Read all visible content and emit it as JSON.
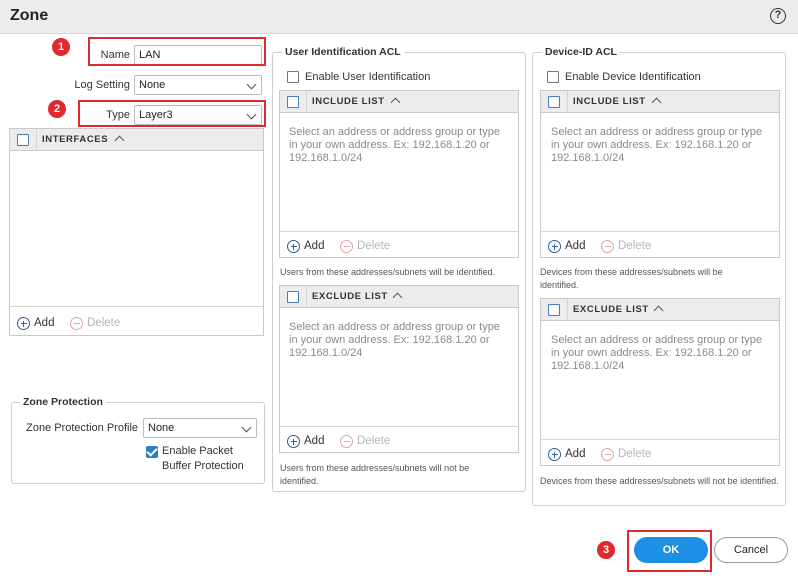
{
  "dialog": {
    "title": "Zone",
    "help": "?"
  },
  "form": {
    "name_label": "Name",
    "name_value": "LAN",
    "log_label": "Log Setting",
    "log_value": "None",
    "type_label": "Type",
    "type_value": "Layer3"
  },
  "interfaces": {
    "header": "INTERFACES",
    "add": "Add",
    "delete": "Delete"
  },
  "zone_protection": {
    "title": "Zone Protection",
    "profile_label": "Zone Protection Profile",
    "profile_value": "None",
    "packet_buffer_line1": "Enable Packet",
    "packet_buffer_line2": "Buffer Protection",
    "packet_buffer_checked": true
  },
  "user_acl": {
    "title": "User Identification ACL",
    "enable_label": "Enable User Identification",
    "include": {
      "header": "INCLUDE LIST",
      "placeholder_l1": "Select an address or address group or type",
      "placeholder_l2": "in your own address. Ex: 192.168.1.20 or",
      "placeholder_l3": "192.168.1.0/24",
      "add": "Add",
      "delete": "Delete"
    },
    "include_note": "Users from these addresses/subnets will be identified.",
    "exclude": {
      "header": "EXCLUDE LIST",
      "placeholder_l1": "Select an address or address group or type",
      "placeholder_l2": "in your own address. Ex: 192.168.1.20 or",
      "placeholder_l3": "192.168.1.0/24",
      "add": "Add",
      "delete": "Delete"
    },
    "exclude_note_l1": "Users from these addresses/subnets will not be",
    "exclude_note_l2": "identified."
  },
  "device_acl": {
    "title": "Device-ID ACL",
    "enable_label": "Enable Device Identification",
    "include": {
      "header": "INCLUDE LIST",
      "placeholder_l1": "Select an address or address group or type",
      "placeholder_l2": "in your own address. Ex: 192.168.1.20 or",
      "placeholder_l3": "192.168.1.0/24",
      "add": "Add",
      "delete": "Delete"
    },
    "include_note_l1": "Devices from these addresses/subnets will be",
    "include_note_l2": "identified.",
    "exclude": {
      "header": "EXCLUDE LIST",
      "placeholder_l1": "Select an address or address group or type",
      "placeholder_l2": "in your own address. Ex: 192.168.1.20 or",
      "placeholder_l3": "192.168.1.0/24",
      "add": "Add",
      "delete": "Delete"
    },
    "exclude_note": "Devices from these addresses/subnets will not be identified."
  },
  "annotations": {
    "badge1": "1",
    "badge2": "2",
    "badge3": "3",
    "highlight_color": "#e0282e"
  },
  "buttons": {
    "ok": "OK",
    "cancel": "Cancel"
  },
  "colors": {
    "accent": "#1e8fe6",
    "header_bg": "#ececec"
  }
}
